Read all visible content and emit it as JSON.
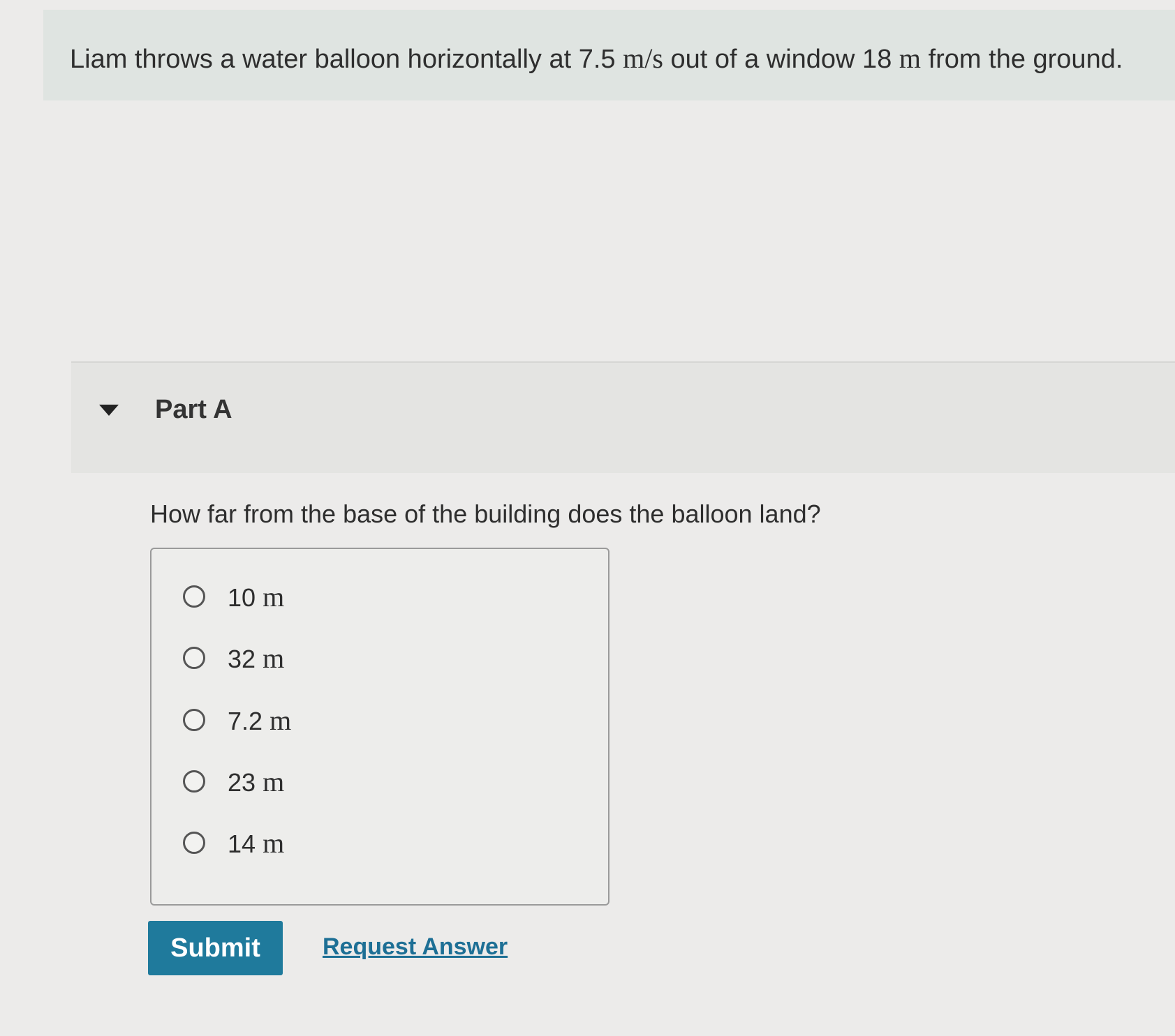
{
  "problem": {
    "text_before_speed": "Liam throws a water balloon horizontally at 7.5 ",
    "speed_unit": "m/s",
    "text_mid": " out of a window 18 ",
    "height_unit": "m",
    "text_after": " from the ground."
  },
  "part": {
    "title": "Part A",
    "expanded": true
  },
  "question": "How far from the base of the building does the balloon land?",
  "choices": [
    {
      "value": "10",
      "unit": "m",
      "selected": false
    },
    {
      "value": "32",
      "unit": "m",
      "selected": false
    },
    {
      "value": "7.2",
      "unit": "m",
      "selected": false
    },
    {
      "value": "23",
      "unit": "m",
      "selected": false
    },
    {
      "value": "14",
      "unit": "m",
      "selected": false
    }
  ],
  "actions": {
    "submit_label": "Submit",
    "request_answer_label": "Request Answer"
  },
  "colors": {
    "submit_bg": "#1f7a9c",
    "link": "#1d6f95"
  }
}
